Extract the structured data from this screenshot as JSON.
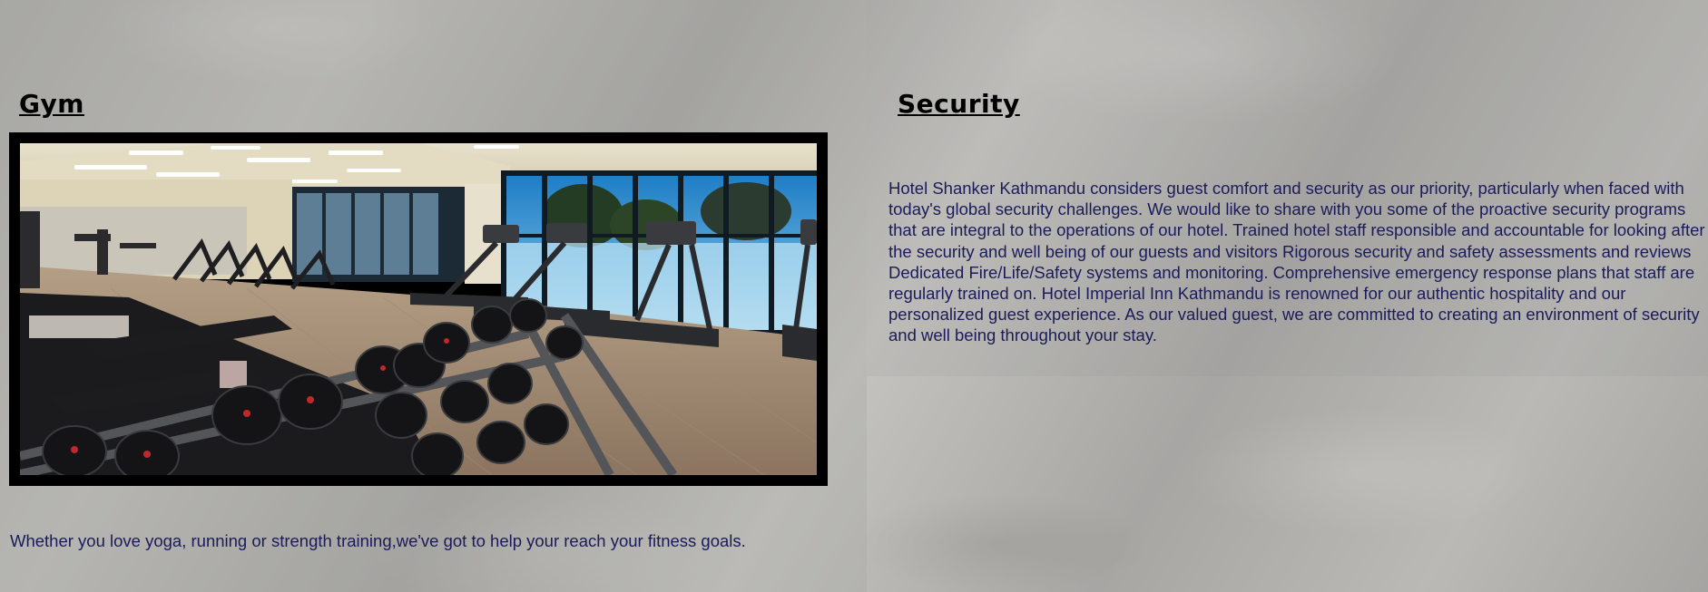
{
  "gym": {
    "title": "Gym",
    "image_alt": "Hotel gym with treadmills, exercise bikes and a dumbbell rack",
    "description": "Whether you love yoga, running or strength training,we've got to help your reach your fitness goals."
  },
  "security": {
    "title": "Security",
    "description": "Hotel Shanker Kathmandu considers guest comfort and security as our priority, particularly when faced with today's global security challenges. We would like to share with you some of the proactive security programs that are integral to the operations of our hotel. Trained hotel staff responsible and accountable for looking after the security and well being of our guests and visitors Rigorous security and safety assessments and reviews Dedicated Fire/Life/Safety systems and monitoring. Comprehensive emergency response plans that staff are regularly trained on. Hotel Imperial Inn Kathmandu is renowned for our authentic hospitality and our personalized guest experience. As our valued guest, we are committed to creating an environment of security and well being throughout your stay."
  },
  "colors": {
    "text": "#1b1b5c",
    "heading": "#000000",
    "frame": "#000000"
  }
}
